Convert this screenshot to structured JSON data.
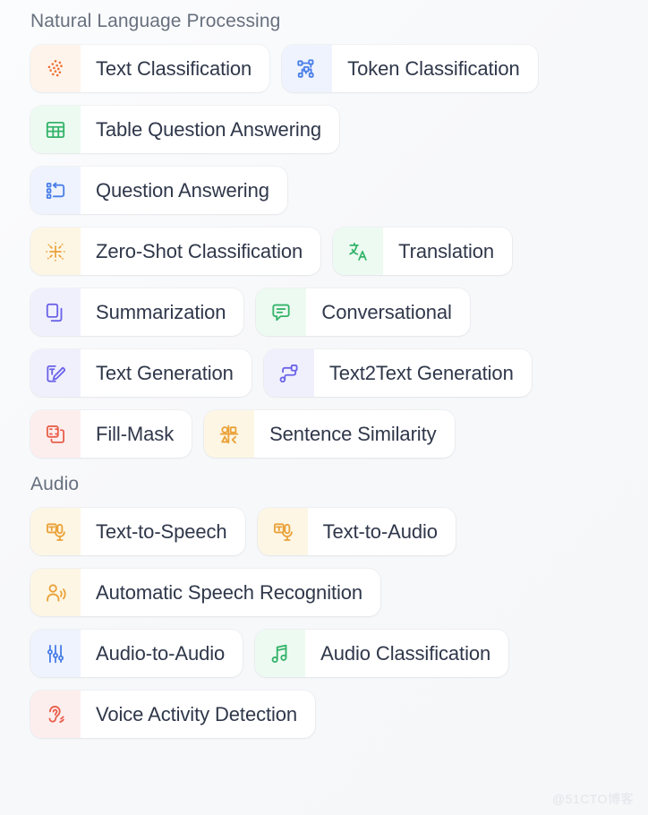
{
  "watermark": "@51CTO博客",
  "sections": [
    {
      "title": "Natural Language Processing",
      "rows": [
        [
          {
            "label": "Text Classification",
            "icon": "scatter-dots-icon",
            "color": "#ee6f31",
            "tint": "t-orange"
          },
          {
            "label": "Token Classification",
            "icon": "node-graph-icon",
            "color": "#4a7fe8",
            "tint": "t-blue"
          }
        ],
        [
          {
            "label": "Table Question Answering",
            "icon": "table-grid-icon",
            "color": "#34b36a",
            "tint": "t-green"
          }
        ],
        [
          {
            "label": "Question Answering",
            "icon": "list-reply-icon",
            "color": "#4a7fe8",
            "tint": "t-blue"
          }
        ],
        [
          {
            "label": "Zero-Shot Classification",
            "icon": "sparkle-scatter-icon",
            "color": "#eaa23a",
            "tint": "t-amber"
          },
          {
            "label": "Translation",
            "icon": "translate-icon",
            "color": "#34b36a",
            "tint": "t-green"
          }
        ],
        [
          {
            "label": "Summarization",
            "icon": "copy-pages-icon",
            "color": "#6c63e8",
            "tint": "t-indigo"
          },
          {
            "label": "Conversational",
            "icon": "speech-bubble-icon",
            "color": "#34b36a",
            "tint": "t-green"
          }
        ],
        [
          {
            "label": "Text Generation",
            "icon": "text-pencil-icon",
            "color": "#6c63e8",
            "tint": "t-indigo"
          },
          {
            "label": "Text2Text Generation",
            "icon": "flow-nodes-icon",
            "color": "#6c63e8",
            "tint": "t-indigo"
          }
        ],
        [
          {
            "label": "Fill-Mask",
            "icon": "mask-squares-icon",
            "color": "#e8604c",
            "tint": "t-rose"
          },
          {
            "label": "Sentence Similarity",
            "icon": "shapes-compare-icon",
            "color": "#eaa23a",
            "tint": "t-amber"
          }
        ]
      ]
    },
    {
      "title": "Audio",
      "rows": [
        [
          {
            "label": "Text-to-Speech",
            "icon": "text-microphone-icon",
            "color": "#eaa23a",
            "tint": "t-amber"
          },
          {
            "label": "Text-to-Audio",
            "icon": "text-microphone-icon",
            "color": "#eaa23a",
            "tint": "t-amber"
          }
        ],
        [
          {
            "label": "Automatic Speech Recognition",
            "icon": "person-speak-icon",
            "color": "#eaa23a",
            "tint": "t-amber"
          }
        ],
        [
          {
            "label": "Audio-to-Audio",
            "icon": "sliders-icon",
            "color": "#4a7fe8",
            "tint": "t-blue"
          },
          {
            "label": "Audio Classification",
            "icon": "music-note-icon",
            "color": "#34b36a",
            "tint": "t-green"
          }
        ],
        [
          {
            "label": "Voice Activity Detection",
            "icon": "ear-sound-icon",
            "color": "#e8604c",
            "tint": "t-rose"
          }
        ]
      ]
    }
  ]
}
